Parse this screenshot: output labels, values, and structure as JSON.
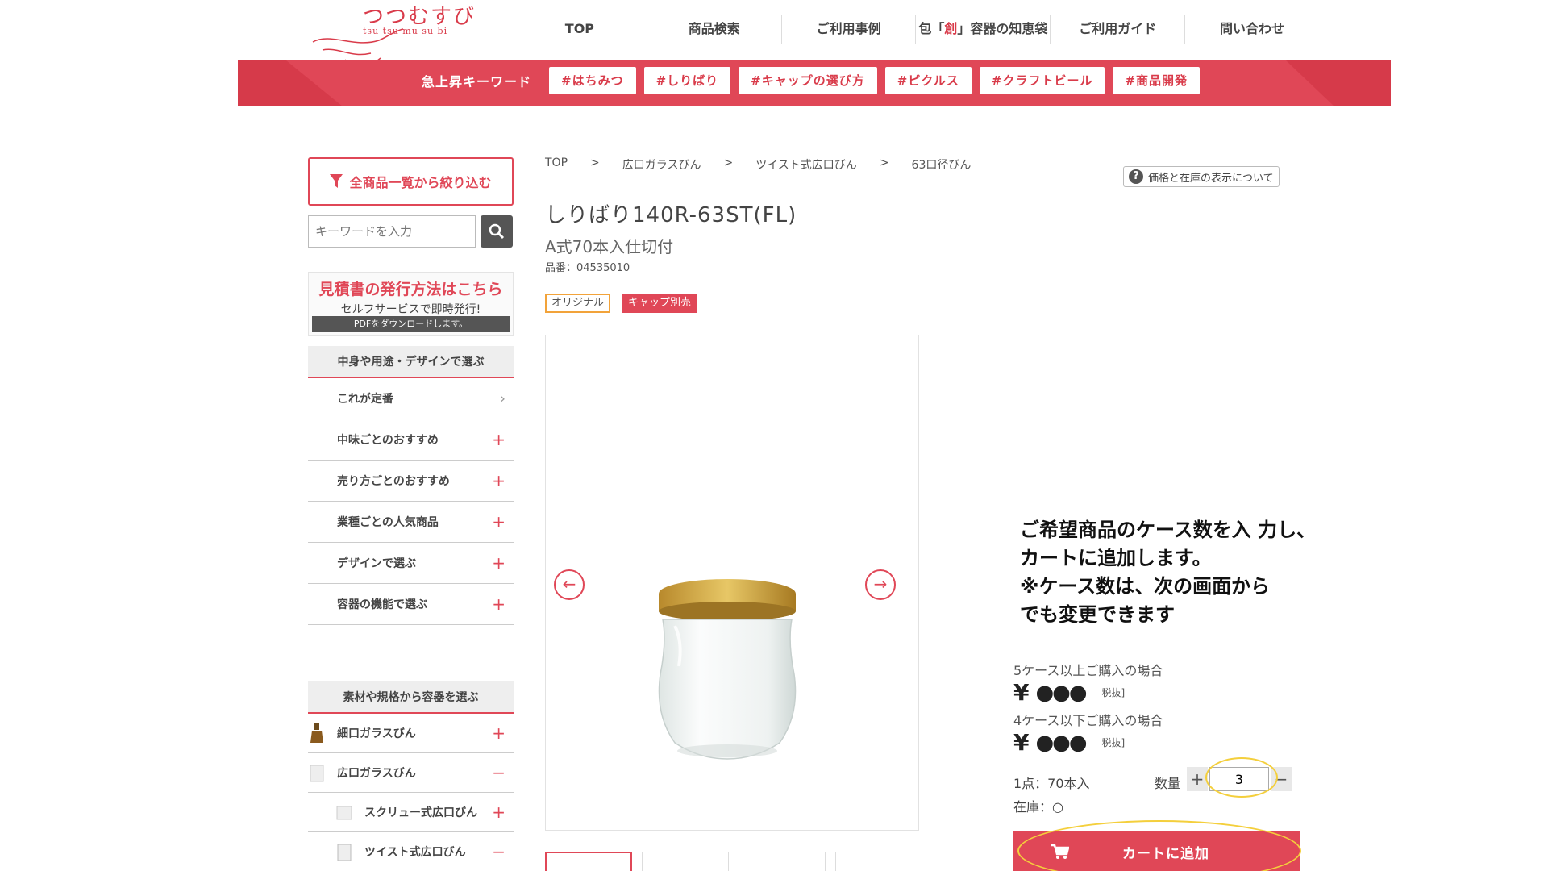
{
  "logo": {
    "jp": "つつむすび",
    "en": "tsu tsu mu su bi"
  },
  "nav": [
    {
      "pre": "",
      "red": "",
      "post": "TOP"
    },
    {
      "pre": "",
      "red": "",
      "post": "商品検索"
    },
    {
      "pre": "",
      "red": "",
      "post": "ご利用事例"
    },
    {
      "pre": "包「",
      "red": "創",
      "post": "」容器の知恵袋"
    },
    {
      "pre": "",
      "red": "",
      "post": "ご利用ガイド"
    },
    {
      "pre": "",
      "red": "",
      "post": "問い合わせ"
    }
  ],
  "keywords": {
    "label": "急上昇キーワード",
    "tags": [
      "#はちみつ",
      "#しりばり",
      "#キャップの選び方",
      "#ピクルス",
      "#クラフトビール",
      "#商品開発"
    ]
  },
  "sidebar": {
    "filter_label": "全商品一覧から絞り込む",
    "search_placeholder": "キーワードを入力",
    "estimate": {
      "line1": "見積書の発行方法はこちら",
      "line2": "セルフサービスで即時発行!",
      "line3": "PDFをダウンロードします。"
    },
    "section1_title": "中身や用途・デザインで選ぶ",
    "section1_items": [
      {
        "label": "これが定番",
        "mark": "›"
      },
      {
        "label": "中味ごとのおすすめ",
        "mark": "+"
      },
      {
        "label": "売り方ごとのおすすめ",
        "mark": "+"
      },
      {
        "label": "業種ごとの人気商品",
        "mark": "+"
      },
      {
        "label": "デザインで選ぶ",
        "mark": "+"
      },
      {
        "label": "容器の機能で選ぶ",
        "mark": "+"
      }
    ],
    "section2_title": "素材や規格から容器を選ぶ",
    "section2_items": [
      {
        "label": "細口ガラスびん",
        "mark": "+"
      },
      {
        "label": "広口ガラスびん",
        "mark": "−"
      },
      {
        "label": "スクリュー式広口びん",
        "mark": "+"
      },
      {
        "label": "ツイスト式広口びん",
        "mark": "−"
      }
    ]
  },
  "breadcrumb": [
    "TOP",
    ">",
    "広口ガラスびん",
    ">",
    "ツイスト式広口びん",
    ">",
    "63口径びん"
  ],
  "price_note": "価格と在庫の表示について",
  "product": {
    "title": "しりばり140R-63ST(FL)",
    "subtitle": "A式70本入仕切付",
    "code": "品番：04535010",
    "tag_original": "オリジナル",
    "tag_cap": "キャップ別売"
  },
  "callout": [
    "ご希望商品のケース数を入 力し、",
    "カートに追加します。",
    "※ケース数は、次の画面から",
    "でも変更できます"
  ],
  "pricing": {
    "label1": "5ケース以上ご購入の場合",
    "price1": "●●●",
    "label2": "4ケース以下ご購入の場合",
    "price2": "●●●",
    "yen": "¥",
    "tax": "税抜]",
    "unit": "1点：70本入",
    "stock": "在庫：○",
    "qty_label": "数量",
    "qty_value": "3",
    "plus": "+",
    "minus": "−"
  },
  "cart_label": "カートに追加",
  "colors": {
    "accent": "#e04757",
    "highlight": "#f4cf3c"
  }
}
